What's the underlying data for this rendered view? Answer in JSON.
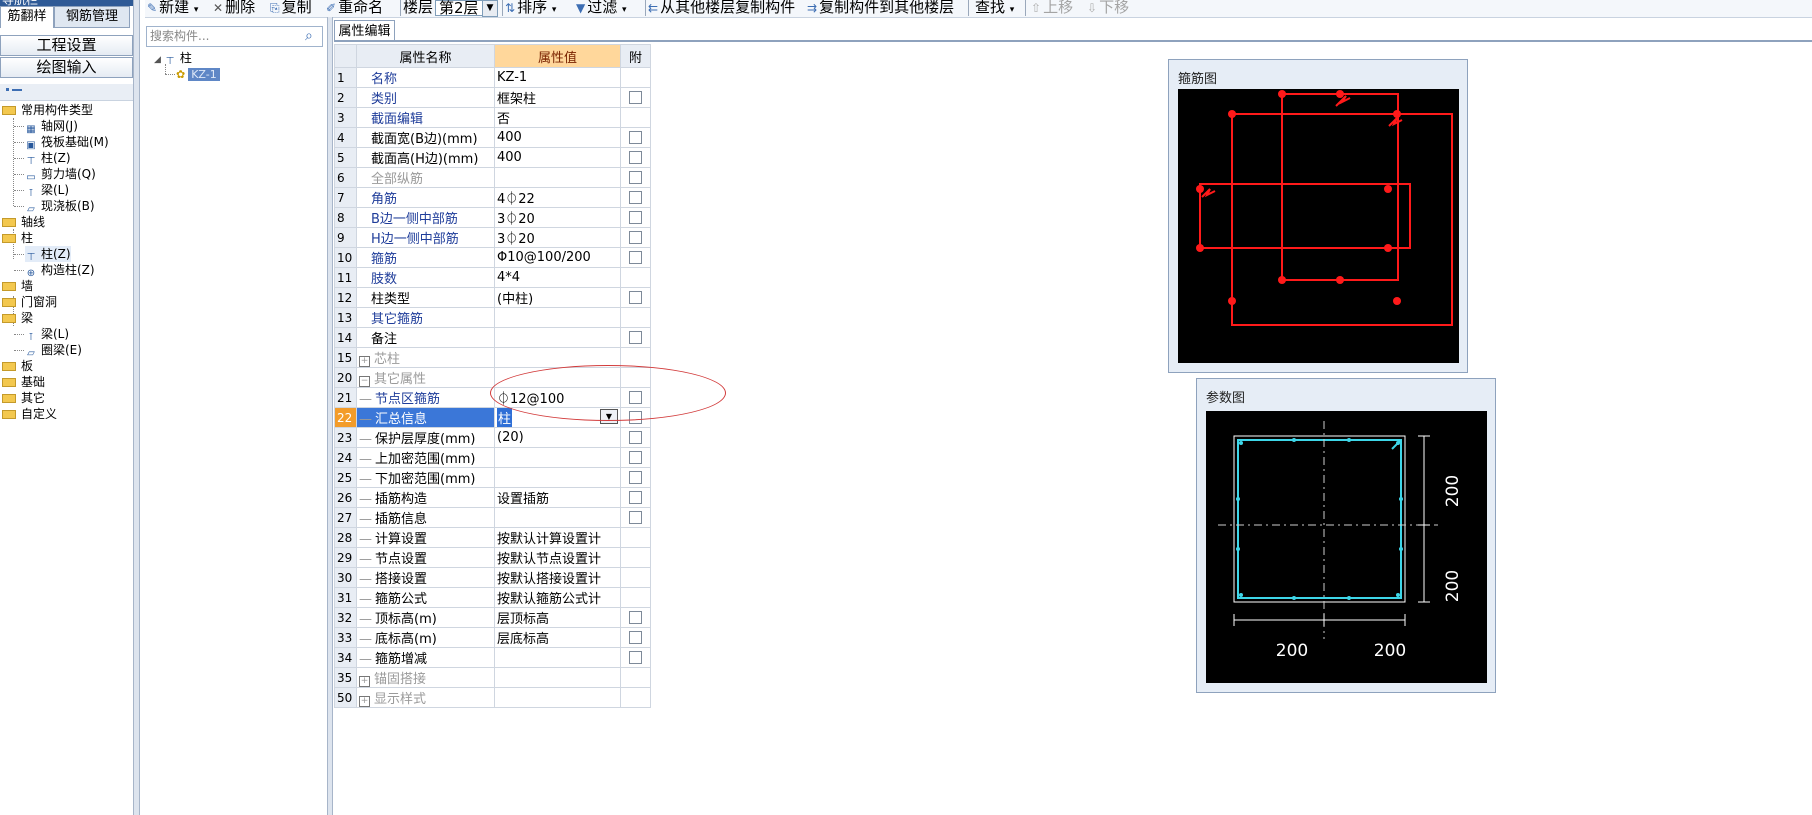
{
  "nav": {
    "tabs": [
      "筋翻样",
      "钢筋管理"
    ],
    "buttons": [
      "工程设置",
      "绘图输入"
    ],
    "tree": [
      {
        "label": "常用构件类型",
        "type": "folder"
      },
      {
        "label": "轴网(J)",
        "type": "item"
      },
      {
        "label": "筏板基础(M)",
        "type": "item"
      },
      {
        "label": "柱(Z)",
        "type": "item"
      },
      {
        "label": "剪力墙(Q)",
        "type": "item"
      },
      {
        "label": "梁(L)",
        "type": "item"
      },
      {
        "label": "现浇板(B)",
        "type": "item"
      },
      {
        "label": "轴线",
        "type": "folder"
      },
      {
        "label": "柱",
        "type": "folder"
      },
      {
        "label": "柱(Z)",
        "type": "item"
      },
      {
        "label": "构造柱(Z)",
        "type": "item"
      },
      {
        "label": "墙",
        "type": "folder"
      },
      {
        "label": "门窗洞",
        "type": "folder"
      },
      {
        "label": "梁",
        "type": "folder"
      },
      {
        "label": "梁(L)",
        "type": "item"
      },
      {
        "label": "圈梁(E)",
        "type": "item"
      },
      {
        "label": "板",
        "type": "folder"
      },
      {
        "label": "基础",
        "type": "folder"
      },
      {
        "label": "其它",
        "type": "folder"
      },
      {
        "label": "自定义",
        "type": "folder"
      }
    ]
  },
  "toolbar": {
    "new": "新建",
    "delete": "删除",
    "copy": "复制",
    "rename": "重命名",
    "floor_label": "楼层",
    "floor_value": "第2层",
    "sort": "排序",
    "filter": "过滤",
    "copy_from": "从其他楼层复制构件",
    "copy_to": "复制构件到其他楼层",
    "find": "查找",
    "move_up": "上移",
    "move_down": "下移"
  },
  "component_tree": {
    "search_placeholder": "搜索构件...",
    "root": "柱",
    "child": "KZ-1"
  },
  "property_editor": {
    "tab": "属性编辑",
    "headers": {
      "name": "属性名称",
      "value": "属性值",
      "attach": "附"
    },
    "rows": [
      {
        "n": "1",
        "name": "名称",
        "value": "KZ-1",
        "style": "blue",
        "chk": false
      },
      {
        "n": "2",
        "name": "类别",
        "value": "框架柱",
        "style": "blue",
        "chk": true
      },
      {
        "n": "3",
        "name": "截面编辑",
        "value": "否",
        "style": "blue",
        "chk": false
      },
      {
        "n": "4",
        "name": "截面宽(B边)(mm)",
        "value": "400",
        "style": "",
        "chk": true
      },
      {
        "n": "5",
        "name": "截面高(H边)(mm)",
        "value": "400",
        "style": "",
        "chk": true
      },
      {
        "n": "6",
        "name": "全部纵筋",
        "value": "",
        "style": "gray",
        "chk": true
      },
      {
        "n": "7",
        "name": "角筋",
        "value": "4⏀22",
        "style": "blue",
        "chk": true
      },
      {
        "n": "8",
        "name": "B边一侧中部筋",
        "value": "3⏀20",
        "style": "blue",
        "chk": true
      },
      {
        "n": "9",
        "name": "H边一侧中部筋",
        "value": "3⏀20",
        "style": "blue",
        "chk": true
      },
      {
        "n": "10",
        "name": "箍筋",
        "value": "Φ10@100/200",
        "style": "blue",
        "chk": true
      },
      {
        "n": "11",
        "name": "肢数",
        "value": "4*4",
        "style": "blue",
        "chk": false
      },
      {
        "n": "12",
        "name": "柱类型",
        "value": "(中柱)",
        "style": "",
        "chk": true
      },
      {
        "n": "13",
        "name": "其它箍筋",
        "value": "",
        "style": "blue",
        "chk": false
      },
      {
        "n": "14",
        "name": "备注",
        "value": "",
        "style": "",
        "chk": true
      },
      {
        "n": "15",
        "name": "芯柱",
        "value": "",
        "style": "gray",
        "chk": false,
        "expander": "+"
      },
      {
        "n": "20",
        "name": "其它属性",
        "value": "",
        "style": "gray",
        "chk": false,
        "expander": "−"
      },
      {
        "n": "21",
        "name": "节点区箍筋",
        "value": "⏀12@100",
        "style": "blue",
        "chk": true,
        "indent": true
      },
      {
        "n": "22",
        "name": "汇总信息",
        "value": "柱",
        "style": "blue",
        "chk": true,
        "indent": true,
        "selected": true
      },
      {
        "n": "23",
        "name": "保护层厚度(mm)",
        "value": "(20)",
        "style": "",
        "chk": true,
        "indent": true
      },
      {
        "n": "24",
        "name": "上加密范围(mm)",
        "value": "",
        "style": "",
        "chk": true,
        "indent": true
      },
      {
        "n": "25",
        "name": "下加密范围(mm)",
        "value": "",
        "style": "",
        "chk": true,
        "indent": true
      },
      {
        "n": "26",
        "name": "插筋构造",
        "value": "设置插筋",
        "style": "",
        "chk": true,
        "indent": true
      },
      {
        "n": "27",
        "name": "插筋信息",
        "value": "",
        "style": "",
        "chk": true,
        "indent": true
      },
      {
        "n": "28",
        "name": "计算设置",
        "value": "按默认计算设置计",
        "style": "",
        "chk": false,
        "indent": true
      },
      {
        "n": "29",
        "name": "节点设置",
        "value": "按默认节点设置计",
        "style": "",
        "chk": false,
        "indent": true
      },
      {
        "n": "30",
        "name": "搭接设置",
        "value": "按默认搭接设置计",
        "style": "",
        "chk": false,
        "indent": true
      },
      {
        "n": "31",
        "name": "箍筋公式",
        "value": "按默认箍筋公式计",
        "style": "",
        "chk": false,
        "indent": true
      },
      {
        "n": "32",
        "name": "顶标高(m)",
        "value": "层顶标高",
        "style": "",
        "chk": true,
        "indent": true
      },
      {
        "n": "33",
        "name": "底标高(m)",
        "value": "层底标高",
        "style": "",
        "chk": true,
        "indent": true
      },
      {
        "n": "34",
        "name": "箍筋增减",
        "value": "",
        "style": "",
        "chk": true,
        "indent": true
      },
      {
        "n": "35",
        "name": "锚固搭接",
        "value": "",
        "style": "gray",
        "chk": false,
        "expander": "+"
      },
      {
        "n": "50",
        "name": "显示样式",
        "value": "",
        "style": "gray",
        "chk": false,
        "expander": "+"
      }
    ]
  },
  "stirrup_panel": {
    "title": "箍筋图",
    "color": "#ff1a1a"
  },
  "param_panel": {
    "title": "参数图",
    "color": "#3ed6e8",
    "dims": [
      "200",
      "200",
      "200",
      "200"
    ]
  }
}
